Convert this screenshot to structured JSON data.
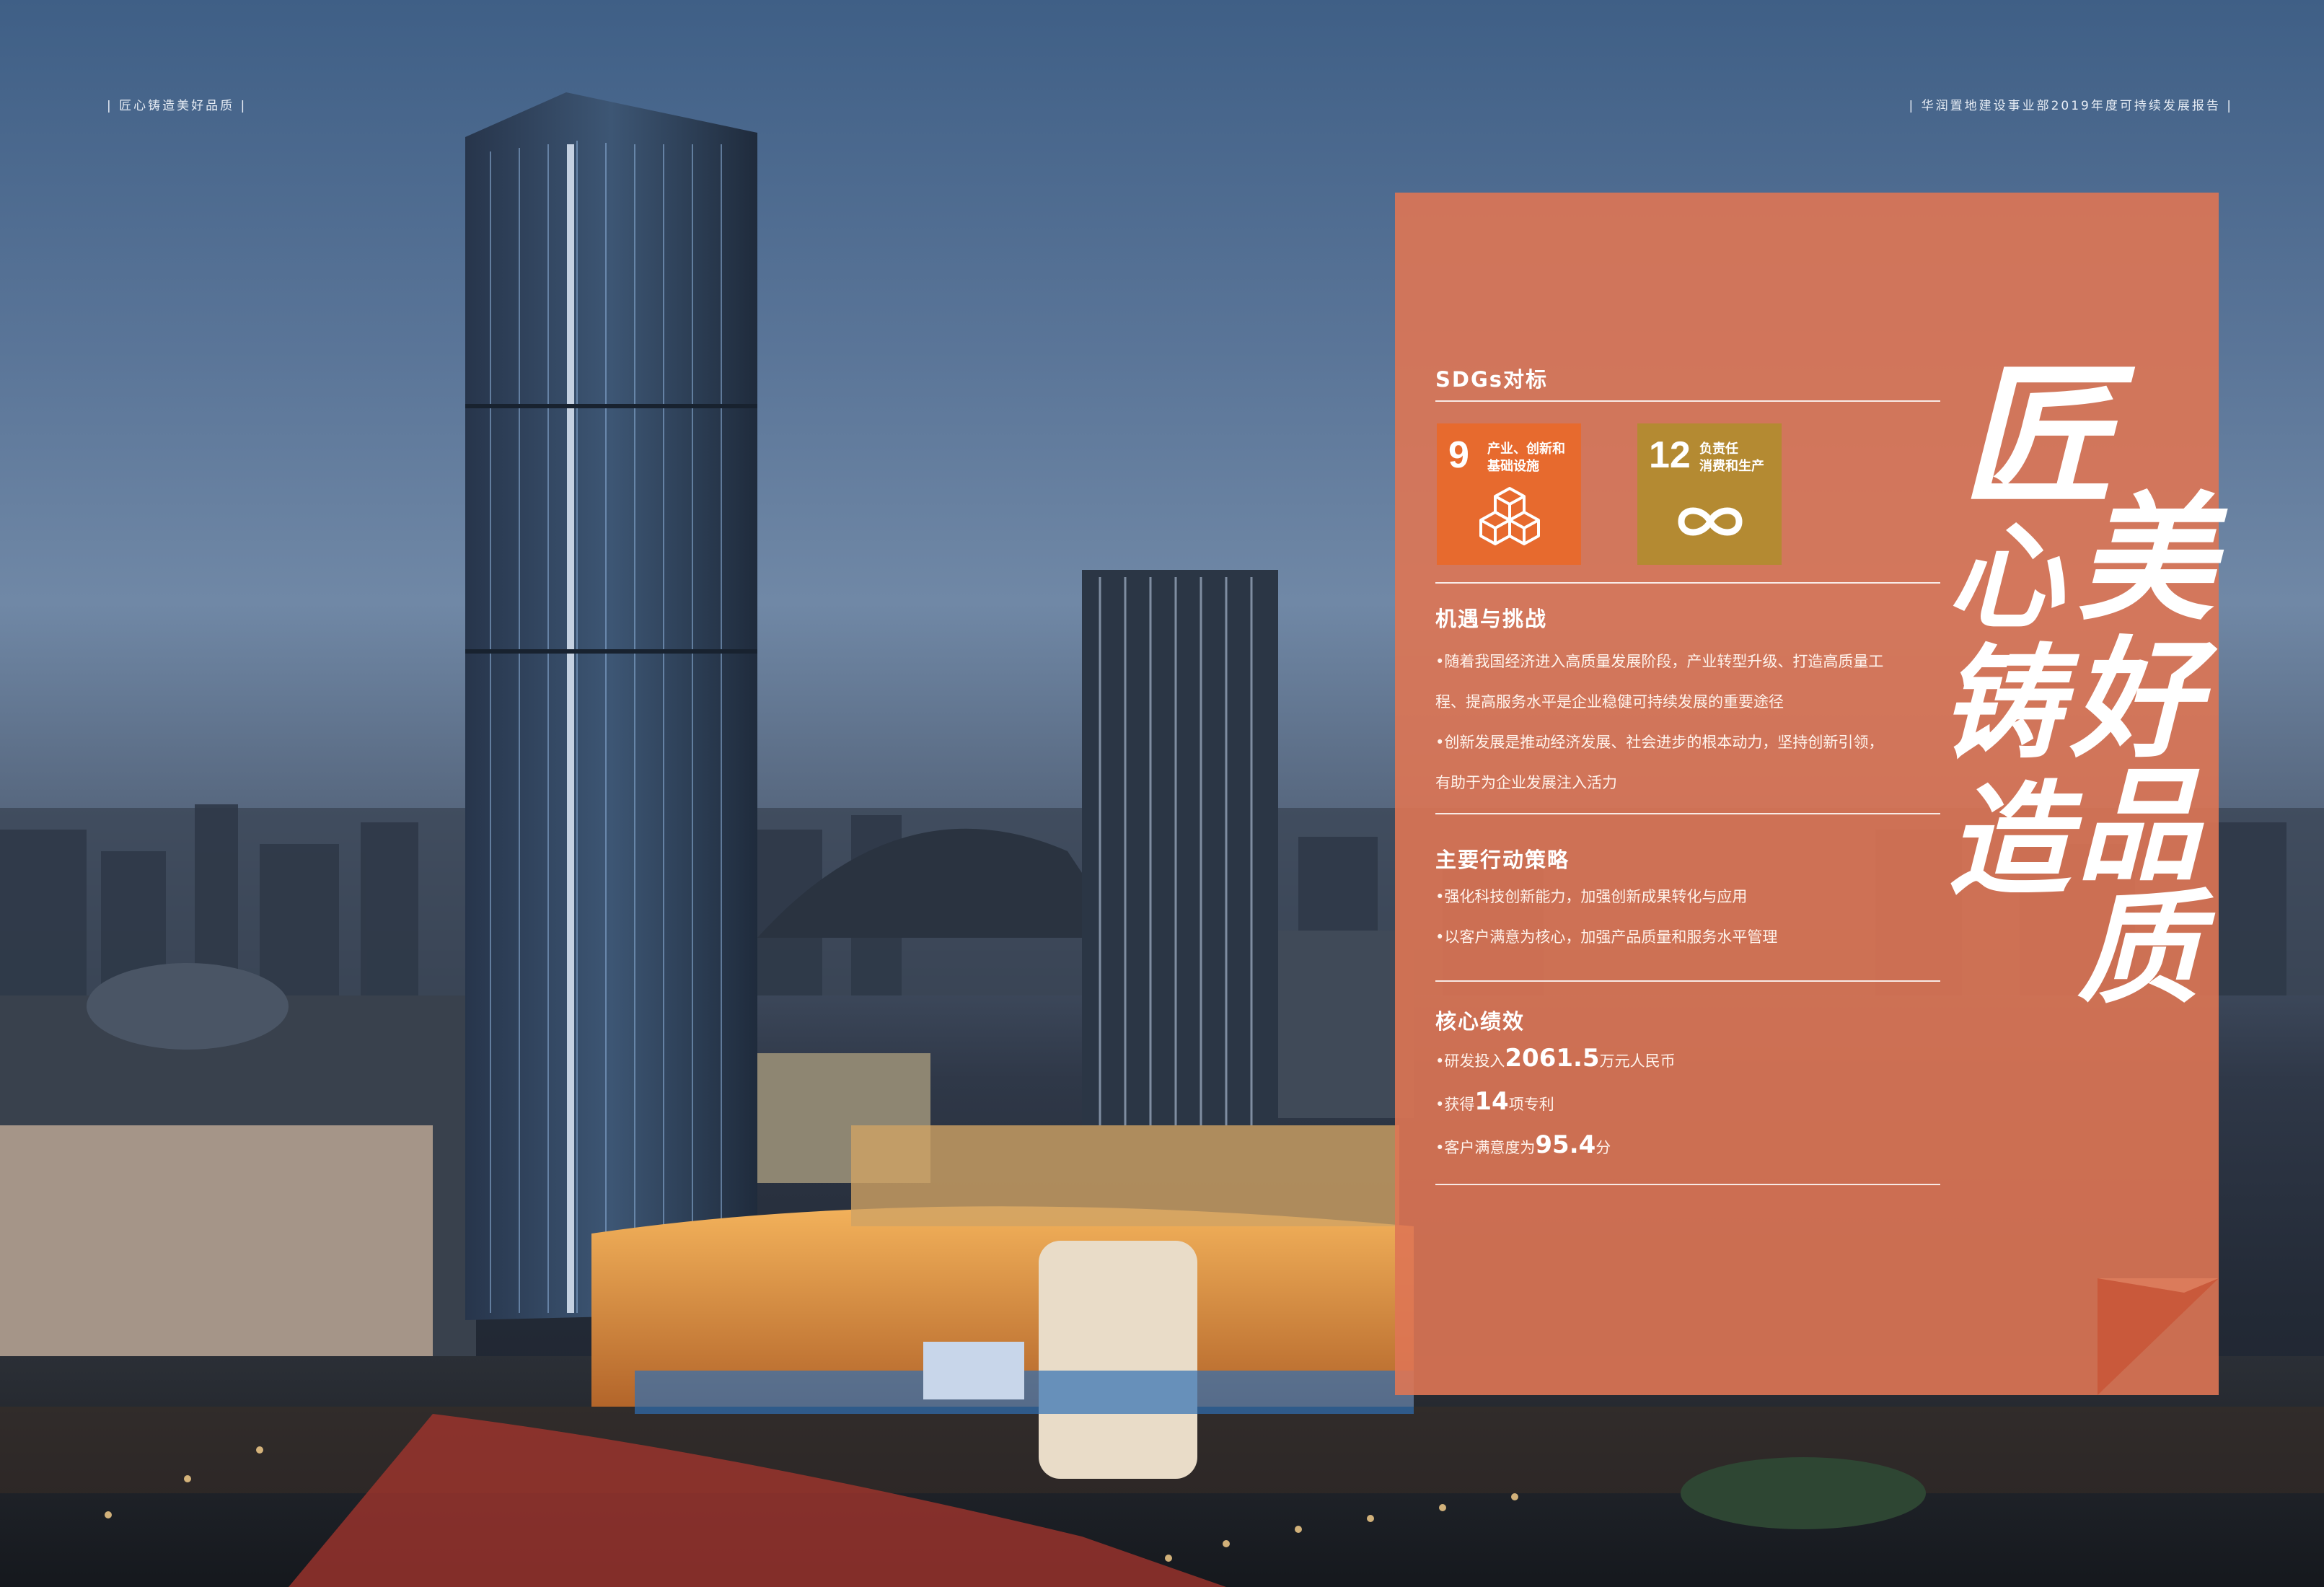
{
  "header": {
    "left": "| 匠心铸造美好品质 |",
    "right": "| 华润置地建设事业部2019年度可持续发展报告 |"
  },
  "panel": {
    "sdgs_title": "SDGs对标",
    "sdg_goals": [
      {
        "number": "9",
        "label_line1": "产业、创新和",
        "label_line2": "基础设施",
        "color": "#e76a2e",
        "icon": "cubes-icon"
      },
      {
        "number": "12",
        "label_line1": "负责任",
        "label_line2": "消费和生产",
        "color": "#b48a32",
        "icon": "infinity-icon"
      }
    ],
    "opportunities": {
      "title": "机遇与挑战",
      "lines": [
        "•随着我国经济进入高质量发展阶段，产业转型升级、打造高质量工",
        "程、提高服务水平是企业稳健可持续发展的重要途径",
        "•创新发展是推动经济发展、社会进步的根本动力，坚持创新引领，",
        "有助于为企业发展注入活力"
      ]
    },
    "strategy": {
      "title": "主要行动策略",
      "lines": [
        "•强化科技创新能力，加强创新成果转化与应用",
        "•以客户满意为核心，加强产品质量和服务水平管理"
      ]
    },
    "performance": {
      "title": "核心绩效",
      "items": [
        {
          "prefix": "•研发投入",
          "value": "2061.5",
          "suffix": "万元人民币"
        },
        {
          "prefix": "•获得",
          "value": "14",
          "suffix": "项专利"
        },
        {
          "prefix": "•客户满意度为",
          "value": "95.4",
          "suffix": "分"
        }
      ]
    },
    "calligraphy": [
      "匠",
      "心",
      "铸",
      "造",
      "美",
      "好",
      "品",
      "质"
    ],
    "accent_color": "#de7554"
  }
}
